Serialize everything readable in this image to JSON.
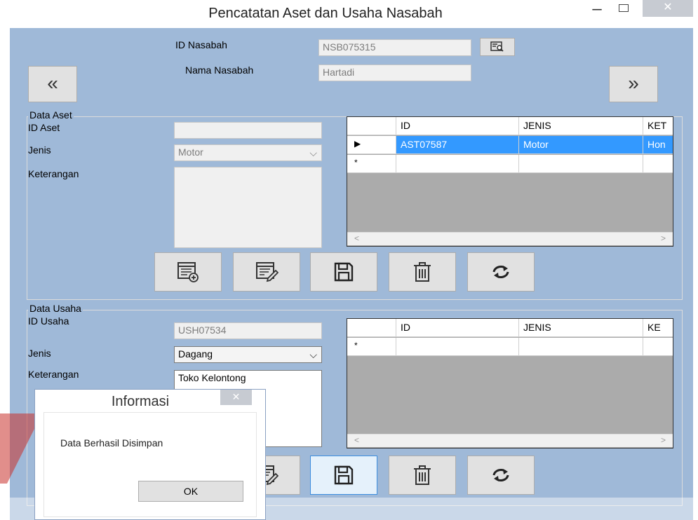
{
  "window": {
    "title": "Pencatatan Aset dan Usaha Nasabah",
    "min_glyph": "–",
    "close_glyph": "✕"
  },
  "header": {
    "id_label": "ID Nasabah",
    "id_value": "NSB075315",
    "name_label": "Nama Nasabah",
    "name_value": "Hartadi",
    "prev_glyph": "«",
    "next_glyph": "»"
  },
  "aset": {
    "group_title": "Data Aset",
    "id_label": "ID Aset",
    "id_value": "",
    "jenis_label": "Jenis",
    "jenis_value": "Motor",
    "keterangan_label": "Keterangan",
    "keterangan_value": "",
    "grid": {
      "columns": [
        "ID",
        "JENIS",
        "KET"
      ],
      "rows": [
        {
          "marker": "▶",
          "cells": [
            "AST07587",
            "Motor",
            "Hon"
          ]
        },
        {
          "marker": "*",
          "cells": [
            "",
            "",
            ""
          ]
        }
      ],
      "scroll_left": "<",
      "scroll_right": ">"
    }
  },
  "usaha": {
    "group_title": "Data Usaha",
    "id_label": "ID Usaha",
    "id_value": "USH07534",
    "jenis_label": "Jenis",
    "jenis_value": "Dagang",
    "keterangan_label": "Keterangan",
    "keterangan_value": "Toko Kelontong",
    "grid": {
      "columns": [
        "ID",
        "JENIS",
        "KE"
      ],
      "rows": [
        {
          "marker": "*",
          "cells": [
            "",
            "",
            ""
          ]
        }
      ],
      "scroll_left": "<",
      "scroll_right": ">"
    }
  },
  "icons": {
    "search": "search-icon",
    "add": "add-record-icon",
    "edit": "edit-record-icon",
    "save": "save-icon",
    "delete": "trash-icon",
    "refresh": "refresh-icon",
    "select": "chevron-down-icon"
  },
  "dialog": {
    "title": "Informasi",
    "close_glyph": "✕",
    "message": "Data Berhasil Disimpan",
    "ok_label": "OK"
  },
  "colors": {
    "client_bg": "#9fb9d8",
    "selected_row": "#3399ff",
    "grid_bg": "#ababab",
    "watermark": "#c8322b"
  }
}
